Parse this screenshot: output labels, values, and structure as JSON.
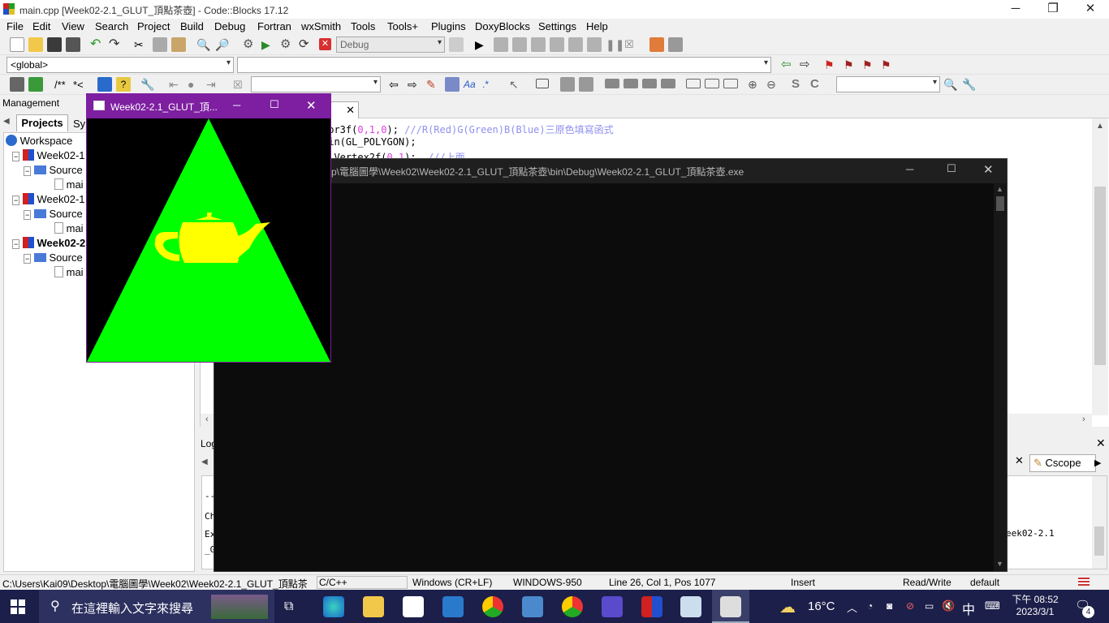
{
  "window": {
    "title": "main.cpp [Week02-2.1_GLUT_頂點茶壺] - Code::Blocks 17.12"
  },
  "menu": [
    "File",
    "Edit",
    "View",
    "Search",
    "Project",
    "Build",
    "Debug",
    "Fortran",
    "wxSmith",
    "Tools",
    "Tools+",
    "Plugins",
    "DoxyBlocks",
    "Settings",
    "Help"
  ],
  "toolbar": {
    "build_target": "Debug",
    "scope": "<global>",
    "comment_labels": [
      "/**",
      "*<"
    ]
  },
  "management": {
    "title": "Management",
    "tabs": [
      "Projects",
      "Sy"
    ],
    "tree": [
      {
        "label": "Workspace",
        "level": 0
      },
      {
        "label": "Week02-1",
        "level": 1
      },
      {
        "label": "Source",
        "level": 2
      },
      {
        "label": "mai",
        "level": 3
      },
      {
        "label": "Week02-1",
        "level": 1
      },
      {
        "label": "Source",
        "level": 2
      },
      {
        "label": "mai",
        "level": 3
      },
      {
        "label": "Week02-2",
        "level": 1
      },
      {
        "label": "Source",
        "level": 2
      },
      {
        "label": "mai",
        "level": 3
      }
    ]
  },
  "editor": {
    "tab_label": "p",
    "lines": [
      {
        "code": "lor3f(",
        "args": "0,1,0",
        "rest": "); ",
        "comment": "///R(Red)G(Green)B(Blue)三原色填寫函式"
      },
      {
        "code": "gin(GL_POLYGON);",
        "args": "",
        "rest": "",
        "comment": ""
      },
      {
        "code": "glVertex2f(",
        "args": "0,1",
        "rest": ");  ",
        "comment": "///上面"
      }
    ]
  },
  "logs": {
    "title": "Log",
    "lines": [
      "--",
      "Ch",
      "Ex",
      "_G"
    ],
    "right_text": "eek02-2.1",
    "cscope_tab": "Cscope"
  },
  "console": {
    "title": "top\\電腦圖學\\Week02\\Week02-2.1_GLUT_頂點茶壺\\bin\\Debug\\Week02-2.1_GLUT_頂點茶壺.exe"
  },
  "glut": {
    "title": "Week02-2.1_GLUT_頂...",
    "triangle_color": "#00ff00",
    "teapot_color": "#ffff00"
  },
  "status": {
    "path": "C:\\Users\\Kai09\\Desktop\\電腦圖學\\Week02\\Week02-2.1_GLUT_頂點茶",
    "lang": "C/C++",
    "eol": "Windows (CR+LF)",
    "encoding": "WINDOWS-950",
    "position": "Line 26, Col 1, Pos 1077",
    "mode": "Insert",
    "access": "Read/Write",
    "profile": "default"
  },
  "taskbar": {
    "search_placeholder": "在這裡輸入文字來搜尋",
    "weather": "16°C",
    "ime": "中",
    "clock_time": "下午 08:52",
    "clock_date": "2023/3/1",
    "notifications": "4"
  }
}
